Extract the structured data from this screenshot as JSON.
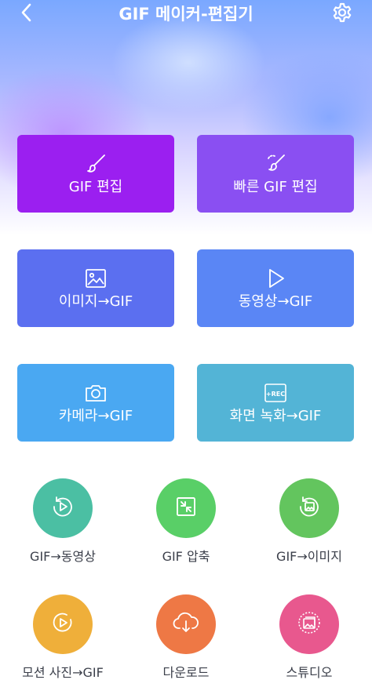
{
  "header": {
    "title": "GIF 메이커-편집기",
    "back_icon": "chevron-left-icon",
    "settings_icon": "gear-icon"
  },
  "colors": {
    "gif_edit": "#9b1ff0",
    "fast_edit": "#8a4ff2",
    "image_to_gif": "#5b6ff0",
    "video_to_gif": "#5a86f5",
    "camera_to_gif": "#4aa8f2",
    "screen_record": "#53b4d6",
    "gif_to_video": "#4bbfa3",
    "gif_compress": "#59cf67",
    "gif_to_image": "#63c55e",
    "motion_photo": "#efaf3a",
    "download": "#ee7845",
    "studio": "#e8588e"
  },
  "cards": {
    "gif_edit": {
      "label": "GIF 편집",
      "icon": "brush-icon"
    },
    "fast_edit": {
      "label": "빠른 GIF 편집",
      "icon": "fast-brush-icon"
    },
    "image_to_gif": {
      "label": "이미지→GIF",
      "icon": "image-icon"
    },
    "video_to_gif": {
      "label": "동영상→GIF",
      "icon": "play-icon"
    },
    "camera_to_gif": {
      "label": "카메라→GIF",
      "icon": "camera-icon"
    },
    "screen_record": {
      "label": "화면 녹화→GIF",
      "icon": "rec-icon",
      "icon_text": "+REC"
    }
  },
  "tools": {
    "gif_to_video": {
      "label": "GIF→동영상",
      "icon": "replay-play-icon"
    },
    "gif_compress": {
      "label": "GIF 압축",
      "icon": "compress-icon"
    },
    "gif_to_image": {
      "label": "GIF→이미지",
      "icon": "replay-image-icon"
    },
    "motion_photo": {
      "label": "모션 사진→GIF",
      "icon": "motion-play-icon"
    },
    "download": {
      "label": "다운로드",
      "icon": "cloud-download-icon"
    },
    "studio": {
      "label": "스튜디오",
      "icon": "gallery-icon"
    }
  }
}
